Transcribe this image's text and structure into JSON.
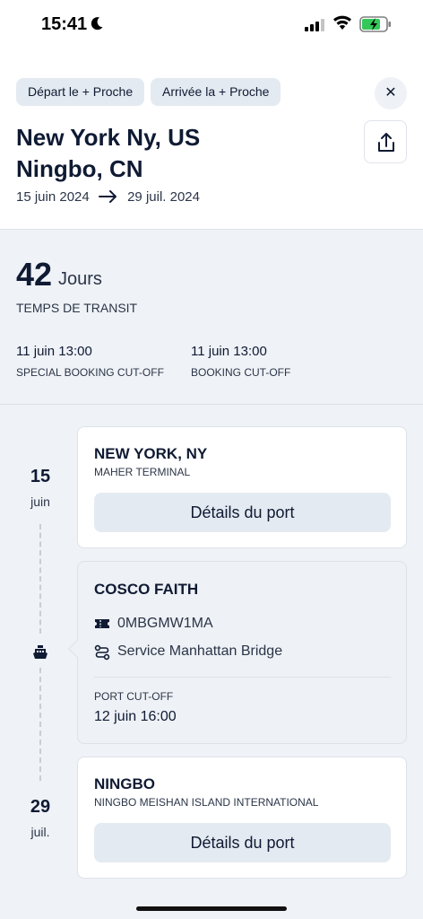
{
  "status_bar": {
    "time": "15:41"
  },
  "filters": {
    "depart_label": "Départ le + Proche",
    "arrivee_label": "Arrivée la + Proche"
  },
  "close_symbol": "✕",
  "route": {
    "origin": "New York Ny, US",
    "destination": "Ningbo, CN",
    "date_start": "15 juin 2024",
    "date_end": "29 juil. 2024"
  },
  "transit": {
    "days": "42",
    "days_unit": "Jours",
    "label": "TEMPS DE TRANSIT",
    "cutoffs": [
      {
        "value": "11 juin 13:00",
        "label": "SPECIAL BOOKING CUT-OFF"
      },
      {
        "value": "11 juin 13:00",
        "label": "BOOKING CUT-OFF"
      }
    ]
  },
  "timeline": {
    "start_day": "15",
    "start_month": "juin",
    "end_day": "29",
    "end_month": "juil."
  },
  "origin_port": {
    "name": "NEW YORK, NY",
    "terminal": "MAHER TERMINAL",
    "button": "Détails du port"
  },
  "vessel": {
    "name": "COSCO FAITH",
    "voyage": "0MBGMW1MA",
    "service": "Service Manhattan Bridge",
    "cutoff_label": "PORT CUT-OFF",
    "cutoff_value": "12 juin 16:00"
  },
  "dest_port": {
    "name": "NINGBO",
    "terminal": "NINGBO MEISHAN ISLAND INTERNATIONAL",
    "button": "Détails du port"
  },
  "icons": {
    "moon": "moon-icon",
    "signal": "signal-icon",
    "wifi": "wifi-icon",
    "battery": "battery-charging-icon",
    "close": "close-icon",
    "share": "share-icon",
    "arrow": "arrow-right-icon",
    "ship": "ship-icon",
    "ticket": "ticket-icon",
    "route": "route-icon"
  },
  "colors": {
    "text": "#0f1a33",
    "chip_bg": "#e4eaf1",
    "page_bg": "#eff2f6",
    "battery_green": "#34c759"
  }
}
